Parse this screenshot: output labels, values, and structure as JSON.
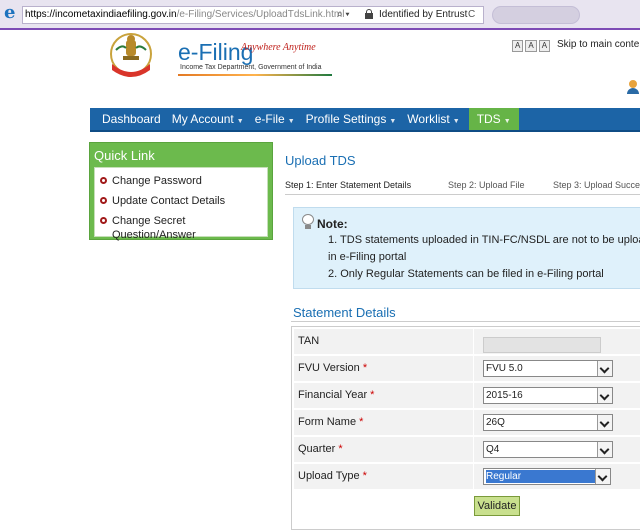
{
  "browser": {
    "url_host": "https://incometaxindiaefiling.gov.in",
    "url_path": "/e-Filing/Services/UploadTdsLink.html",
    "security_text": "Identified by Entrust",
    "search_glyph": "⌕ ▾",
    "refresh_glyph": "C"
  },
  "header": {
    "logo_title": "e-Filing",
    "logo_tagline": "Anywhere Anytime",
    "logo_subtitle": "Income Tax Department, Government of India",
    "font_sizes": [
      "A",
      "A",
      "A"
    ],
    "skip_link": "Skip to main conte"
  },
  "nav": {
    "items": [
      "Dashboard",
      "My Account",
      "e-File",
      "Profile Settings",
      "Worklist",
      "TDS"
    ],
    "active": "TDS"
  },
  "quick_link": {
    "title": "Quick Link",
    "items": [
      "Change Password",
      "Update Contact Details",
      "Change Secret Question/Answer"
    ]
  },
  "page": {
    "title": "Upload TDS",
    "steps": [
      "Step 1: Enter Statement Details",
      "Step 2: Upload File",
      "Step 3: Upload Succe"
    ]
  },
  "note": {
    "title": "Note:",
    "items": [
      "1.  TDS statements uploaded in TIN-FC/NSDL are not to be uploa in e-Filing portal",
      "2.  Only Regular Statements can be filed in e-Filing portal"
    ]
  },
  "statement": {
    "title": "Statement Details",
    "tan_label": "TAN",
    "fields": [
      {
        "label": "FVU Version",
        "value": "FVU 5.0"
      },
      {
        "label": "Financial Year",
        "value": "2015-16"
      },
      {
        "label": "Form Name",
        "value": "26Q"
      },
      {
        "label": "Quarter",
        "value": "Q4"
      },
      {
        "label": "Upload Type",
        "value": "Regular"
      }
    ],
    "required_mark": "*",
    "validate_label": "Validate"
  },
  "colors": {
    "nav": "#1c64a6",
    "active": "#66b447",
    "accent": "#1a6fb3",
    "note_bg": "#dff1fb"
  }
}
